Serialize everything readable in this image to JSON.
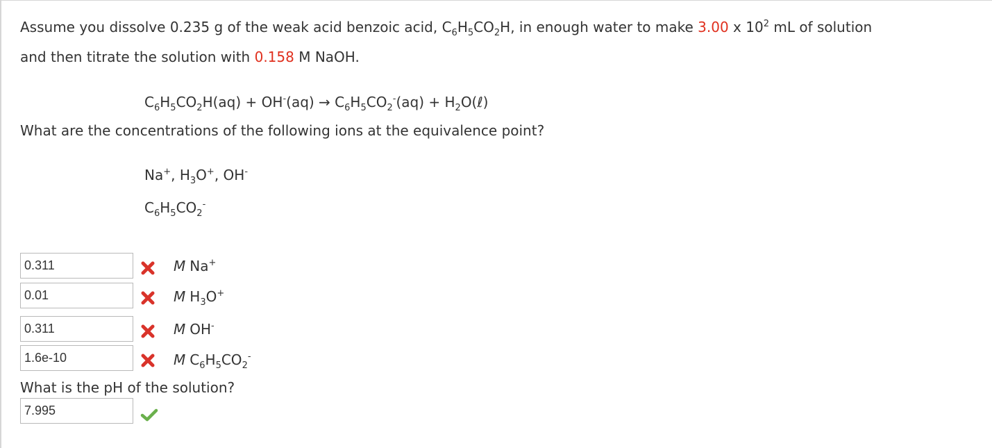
{
  "question": {
    "p1_a": "Assume you dissolve 0.235 g of the weak acid benzoic acid, C",
    "p1_sub6": "6",
    "p1_h": "H",
    "p1_sub5": "5",
    "p1_co": "CO",
    "p1_sub2": "2",
    "p1_b": "H, in enough water to make ",
    "volume_value": "3.00",
    "p1_c": " x 10",
    "p1_sup2": "2",
    "p1_d": " mL of solution",
    "p2_a": "and then titrate the solution with ",
    "naoh_value": "0.158",
    "p2_b": " M NaOH."
  },
  "equation": {
    "c": "C",
    "s6": "6",
    "h": "H",
    "s5": "5",
    "co": "CO",
    "s2": "2",
    "t1": "H(aq) + OH",
    "minus": "-",
    "t2": "(aq) → C",
    "t3": "(aq) + H",
    "t4": "O(ℓ)"
  },
  "prompt_ions": "What are the concentrations of the following ions at the equivalence point?",
  "ions": {
    "line1_a": "Na",
    "plus": "+",
    "line1_b": ", H",
    "s3": "3",
    "line1_c": "O",
    "line1_d": ", OH",
    "minus": "-"
  },
  "answers": [
    {
      "value": "0.311",
      "status": "incorrect",
      "m": "M",
      "unit": "Na",
      "sup": "+"
    },
    {
      "value": "0.01",
      "status": "incorrect",
      "m": "M",
      "unit_a": "H",
      "sub": "3",
      "unit_b": "O",
      "sup": "+"
    },
    {
      "value": "0.311",
      "status": "incorrect",
      "m": "M",
      "unit": "OH",
      "sup": "-"
    },
    {
      "value": "1.6e-10",
      "status": "incorrect",
      "m": "M",
      "sup": "-"
    }
  ],
  "prompt_ph": "What is the pH of the solution?",
  "ph_answer": {
    "value": "7.995",
    "status": "correct"
  },
  "colors": {
    "accent_red": "#e0301e",
    "wrong_red": "#d9332a",
    "right_green": "#6ab04c"
  },
  "icons": {
    "incorrect": "x-mark-icon",
    "correct": "check-mark-icon"
  }
}
